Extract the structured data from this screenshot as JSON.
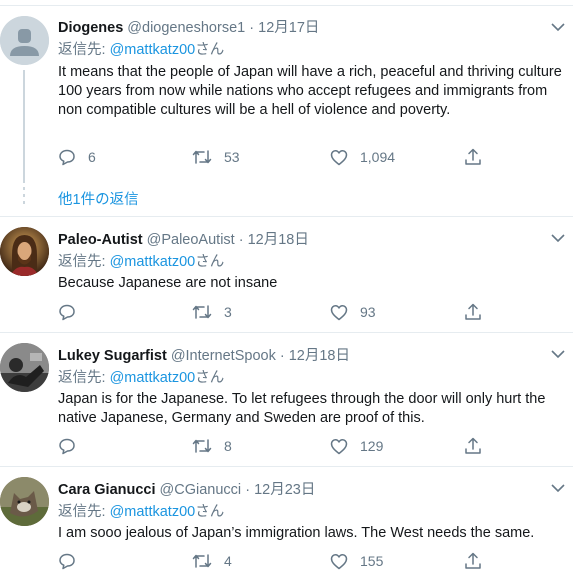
{
  "reply_prefix": "返信先: ",
  "reply_suffix": "さん",
  "colors": {
    "link": "#1b95e0",
    "muted": "#657786",
    "border": "#e6ecf0",
    "text": "#14171a"
  },
  "icons": {
    "reply": "reply-icon",
    "retweet": "retweet-icon",
    "like": "like-icon",
    "share": "share-icon",
    "caret": "chevron-down-icon"
  },
  "tweets": [
    {
      "name": "Diogenes",
      "handle": "@diogeneshorse1",
      "separator": "·",
      "date": "12月17日",
      "mention": "@mattkatz00",
      "text": "It means that the people of Japan will have a rich, peaceful and thriving culture 100 years from now while nations who accept refugees and immigrants from non compatible cultures will be a hell of violence and poverty.",
      "replies": "6",
      "retweets": "53",
      "likes": "1,094",
      "more_replies": "他1件の返信"
    },
    {
      "name": "Paleo-Autist",
      "handle": "@PaleoAutist",
      "separator": "·",
      "date": "12月18日",
      "mention": "@mattkatz00",
      "text": "Because Japanese are not insane",
      "replies": "",
      "retweets": "3",
      "likes": "93"
    },
    {
      "name": "Lukey Sugarfist",
      "handle": "@InternetSpook",
      "separator": "·",
      "date": "12月18日",
      "mention": "@mattkatz00",
      "text": "Japan is for the Japanese. To let refugees through the door will only hurt the native Japanese,  Germany and Sweden are proof of this.",
      "replies": "",
      "retweets": "8",
      "likes": "129"
    },
    {
      "name": "Cara Gianucci",
      "handle": "@CGianucci",
      "separator": "·",
      "date": "12月23日",
      "mention": "@mattkatz00",
      "text": "I am sooo jealous of Japan’s immigration laws. The West needs the same.",
      "replies": "",
      "retweets": "4",
      "likes": "155"
    }
  ]
}
